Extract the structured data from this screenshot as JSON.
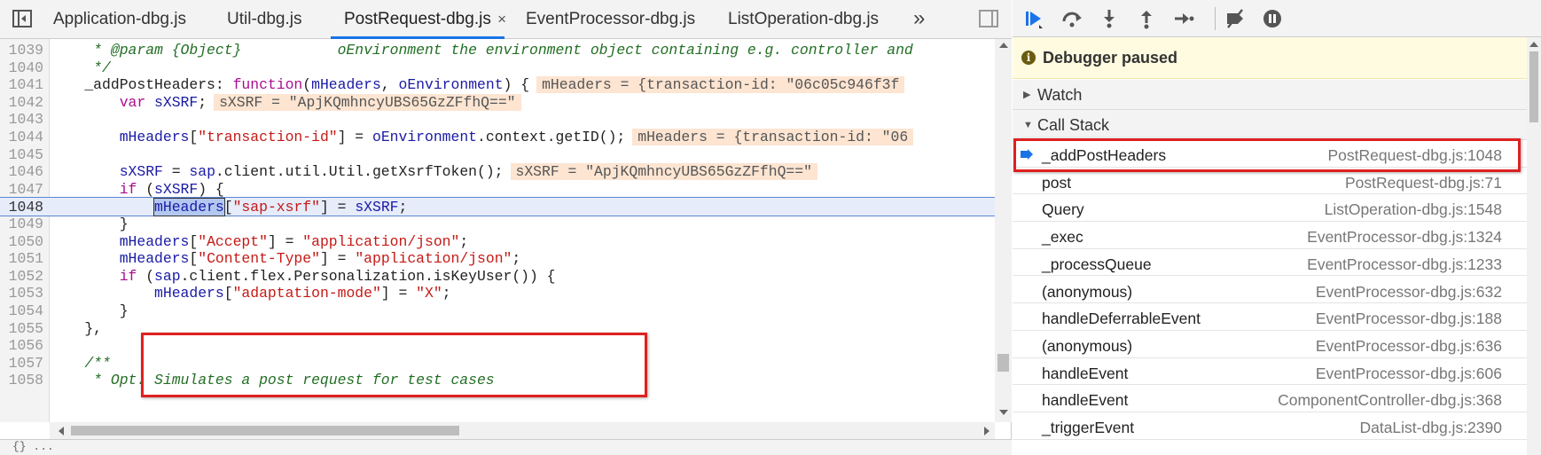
{
  "tabs": [
    {
      "label": "Application-dbg.js",
      "active": false
    },
    {
      "label": "Util-dbg.js",
      "active": false
    },
    {
      "label": "PostRequest-dbg.js",
      "active": true,
      "close": "×"
    },
    {
      "label": "EventProcessor-dbg.js",
      "active": false
    },
    {
      "label": "ListOperation-dbg.js",
      "active": false
    }
  ],
  "tab_overflow": "»",
  "code": {
    "lines": [
      {
        "n": "1039",
        "parts": [
          [
            "cmt",
            "     * @param {Object}           oEnvironment the environment object containing e.g. controller and"
          ]
        ]
      },
      {
        "n": "1040",
        "parts": [
          [
            "cmt",
            "     */"
          ]
        ]
      },
      {
        "n": "1041",
        "parts": [
          [
            "fn",
            "    _addPostHeaders: "
          ],
          [
            "kw",
            "function"
          ],
          [
            "fn",
            "("
          ],
          [
            "var",
            "mHeaders"
          ],
          [
            "fn",
            ", "
          ],
          [
            "var",
            "oEnvironment"
          ],
          [
            "fn",
            ") {"
          ],
          [
            "val",
            "mHeaders = {transaction-id: \"06c05c946f3f"
          ]
        ]
      },
      {
        "n": "1042",
        "parts": [
          [
            "kw",
            "        var "
          ],
          [
            "var",
            "sXSRF"
          ],
          [
            "fn",
            ";"
          ],
          [
            "val",
            "sXSRF = \"ApjKQmhncyUBS65GzZFfhQ==\""
          ]
        ]
      },
      {
        "n": "1043",
        "parts": []
      },
      {
        "n": "1044",
        "parts": [
          [
            "var",
            "        mHeaders"
          ],
          [
            "fn",
            "["
          ],
          [
            "str",
            "\"transaction-id\""
          ],
          [
            "fn",
            "] = "
          ],
          [
            "var",
            "oEnvironment"
          ],
          [
            "fn",
            ".context.getID();"
          ],
          [
            "val",
            "mHeaders = {transaction-id: \"06"
          ]
        ]
      },
      {
        "n": "1045",
        "parts": []
      },
      {
        "n": "1046",
        "parts": [
          [
            "var",
            "        sXSRF"
          ],
          [
            "fn",
            " = "
          ],
          [
            "var",
            "sap"
          ],
          [
            "fn",
            ".client.util.Util.getXsrfToken();"
          ],
          [
            "val",
            "sXSRF = \"ApjKQmhncyUBS65GzZFfhQ==\""
          ]
        ]
      },
      {
        "n": "1047",
        "parts": [
          [
            "kw",
            "        if "
          ],
          [
            "fn",
            "("
          ],
          [
            "var",
            "sXSRF"
          ],
          [
            "fn",
            ") {"
          ]
        ]
      },
      {
        "n": "1048",
        "current": true,
        "parts": [
          [
            "fn",
            "            "
          ],
          [
            "sel",
            "mHeaders"
          ],
          [
            "fn",
            "["
          ],
          [
            "str",
            "\"sap-xsrf\""
          ],
          [
            "fn",
            "] = "
          ],
          [
            "var",
            "sXSRF"
          ],
          [
            "fn",
            ";"
          ]
        ]
      },
      {
        "n": "1049",
        "parts": [
          [
            "fn",
            "        }"
          ]
        ]
      },
      {
        "n": "1050",
        "parts": [
          [
            "var",
            "        mHeaders"
          ],
          [
            "fn",
            "["
          ],
          [
            "str",
            "\"Accept\""
          ],
          [
            "fn",
            "] = "
          ],
          [
            "str",
            "\"application/json\""
          ],
          [
            "fn",
            ";"
          ]
        ]
      },
      {
        "n": "1051",
        "parts": [
          [
            "var",
            "        mHeaders"
          ],
          [
            "fn",
            "["
          ],
          [
            "str",
            "\"Content-Type\""
          ],
          [
            "fn",
            "] = "
          ],
          [
            "str",
            "\"application/json\""
          ],
          [
            "fn",
            ";"
          ]
        ]
      },
      {
        "n": "1052",
        "parts": [
          [
            "kw",
            "        if "
          ],
          [
            "fn",
            "("
          ],
          [
            "var",
            "sap"
          ],
          [
            "fn",
            ".client.flex.Personalization.isKeyUser()) {"
          ]
        ]
      },
      {
        "n": "1053",
        "parts": [
          [
            "var",
            "            mHeaders"
          ],
          [
            "fn",
            "["
          ],
          [
            "str",
            "\"adaptation-mode\""
          ],
          [
            "fn",
            "] = "
          ],
          [
            "str",
            "\"X\""
          ],
          [
            "fn",
            ";"
          ]
        ]
      },
      {
        "n": "1054",
        "parts": [
          [
            "fn",
            "        }"
          ]
        ]
      },
      {
        "n": "1055",
        "parts": [
          [
            "fn",
            "    },"
          ]
        ]
      },
      {
        "n": "1056",
        "parts": []
      },
      {
        "n": "1057",
        "parts": [
          [
            "cmt",
            "    /**"
          ]
        ]
      },
      {
        "n": "1058",
        "parts": [
          [
            "cmt",
            "     * Opt. Simulates a post request for test cases"
          ]
        ]
      }
    ]
  },
  "status_text": "{}  ...",
  "debugger": {
    "paused_label": "Debugger paused",
    "info_glyph": "i",
    "watch_label": "Watch",
    "callstack_label": "Call Stack",
    "frames": [
      {
        "name": "_addPostHeaders",
        "location": "PostRequest-dbg.js:1048",
        "current": true
      },
      {
        "name": "post",
        "location": "PostRequest-dbg.js:71"
      },
      {
        "name": "Query",
        "location": "ListOperation-dbg.js:1548"
      },
      {
        "name": "_exec",
        "location": "EventProcessor-dbg.js:1324"
      },
      {
        "name": "_processQueue",
        "location": "EventProcessor-dbg.js:1233"
      },
      {
        "name": "(anonymous)",
        "location": "EventProcessor-dbg.js:632"
      },
      {
        "name": "handleDeferrableEvent",
        "location": "EventProcessor-dbg.js:188"
      },
      {
        "name": "(anonymous)",
        "location": "EventProcessor-dbg.js:636"
      },
      {
        "name": "handleEvent",
        "location": "EventProcessor-dbg.js:606"
      },
      {
        "name": "handleEvent",
        "location": "ComponentController-dbg.js:368"
      },
      {
        "name": "_triggerEvent",
        "location": "DataList-dbg.js:2390"
      }
    ]
  },
  "colors": {
    "accent": "#1a73e8",
    "highlight_box": "#e02020",
    "paused_bg": "#fffbe0",
    "inline_value_bg": "#fde5d2"
  }
}
